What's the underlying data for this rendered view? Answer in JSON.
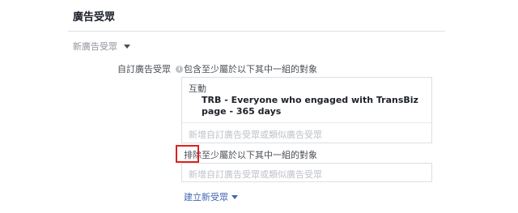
{
  "section": {
    "title": "廣告受眾"
  },
  "audience_dropdown": {
    "label": "新廣告受眾"
  },
  "custom_audience": {
    "label": "自訂廣告受眾",
    "info_icon": "info-icon",
    "include_text": "包含至少屬於以下其中一組的對象",
    "include_box": {
      "category": "互動",
      "item": "TRB - Everyone who engaged with TransBiz page - 365 days",
      "add_placeholder": "新增自訂廣告受眾或類似廣告受眾"
    },
    "exclude_text": "排除至少屬於以下其中一組的對象",
    "exclude_box": {
      "add_placeholder": "新增自訂廣告受眾或類似廣告受眾"
    },
    "create_link": "建立新受眾"
  },
  "colors": {
    "highlight": "#e02020",
    "link": "#4267b2",
    "placeholder": "#bec2c9"
  }
}
